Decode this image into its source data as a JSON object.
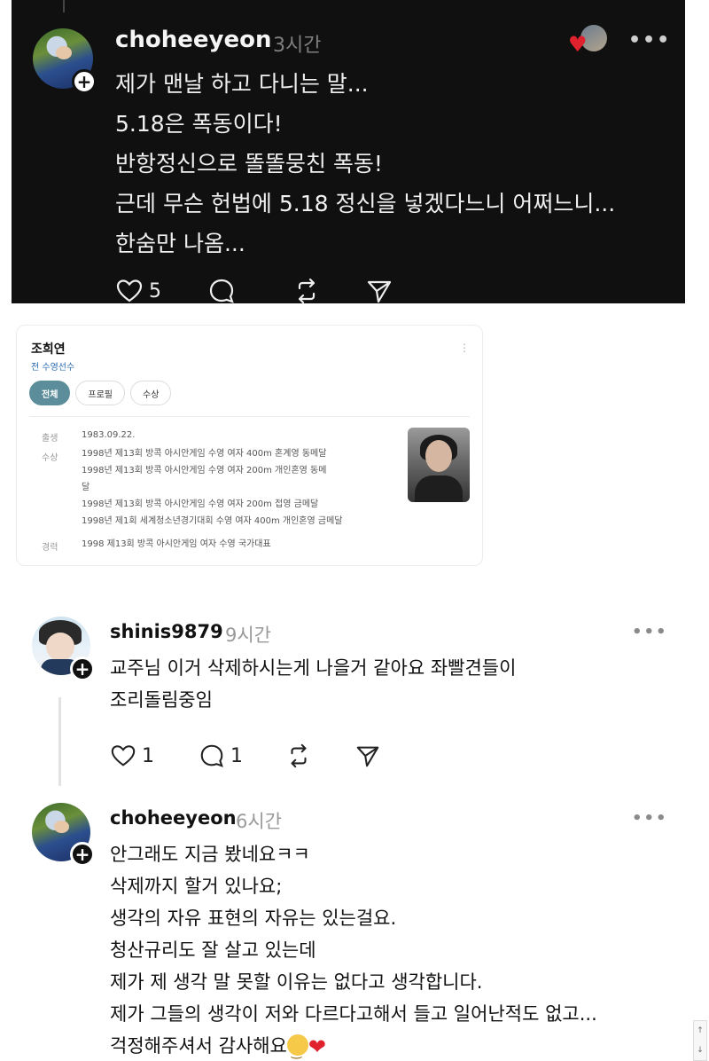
{
  "post": {
    "username": "choheeyeon",
    "time": "3시간",
    "lines": [
      "제가 맨날 하고 다니는 말...",
      "5.18은 폭동이다!",
      "반항정신으로 똘똘뭉친 폭동!",
      "근데 무슨 헌법에 5.18 정신을 넣겠다느니 어쩌느니...",
      "한숨만 나옴..."
    ],
    "like_count": "5",
    "icons": [
      "heart-icon",
      "comment-icon",
      "repost-icon",
      "share-icon"
    ]
  },
  "card": {
    "name": "조희연",
    "subtitle": "전 수영선수",
    "tabs": [
      "전체",
      "프로필",
      "수상"
    ],
    "birth_label": "출생",
    "birth_value": "1983.09.22.",
    "awards_label": "수상",
    "awards": [
      "1998년 제13회 방콕 아시안게임 수영 여자 400m 혼계영 동메달",
      "1998년 제13회 방콕 아시안게임 수영 여자 200m 개인혼영 동메",
      "달",
      "1998년 제13회 방콕 아시안게임 수영 여자 200m 접영 금메달",
      "1998년 제1회 세계청소년경기대회 수영 여자 400m 개인혼영 금메달"
    ],
    "career_label": "경력",
    "career_value": "1998 제13회 방콕 아시안게임 여자 수영 국가대표"
  },
  "comment1": {
    "username": "shinis9879",
    "time": "9시간",
    "lines": [
      "교주님 이거 삭제하시는게 나을거 같아요 좌빨견들이",
      "조리돌림중임"
    ],
    "like_count": "1",
    "reply_count": "1"
  },
  "comment2": {
    "username": "choheeyeon",
    "time": "6시간",
    "lines": [
      "안그래도 지금 봤네요ㅋㅋ",
      "삭제까지 할거 있나요;",
      "생각의 자유 표현의 자유는 있는걸요.",
      "청산규리도 잘 살고 있는데",
      "제가 제 생각 말 못할 이유는 없다고 생각합니다.",
      "제가 그들의 생각이 저와 다르다고해서 들고 일어난적도 없고...",
      "걱정해주셔서 감사해요"
    ]
  },
  "more_label": "•••",
  "plus_label": "+",
  "scroll": {
    "up": "↑",
    "down": "↓"
  }
}
